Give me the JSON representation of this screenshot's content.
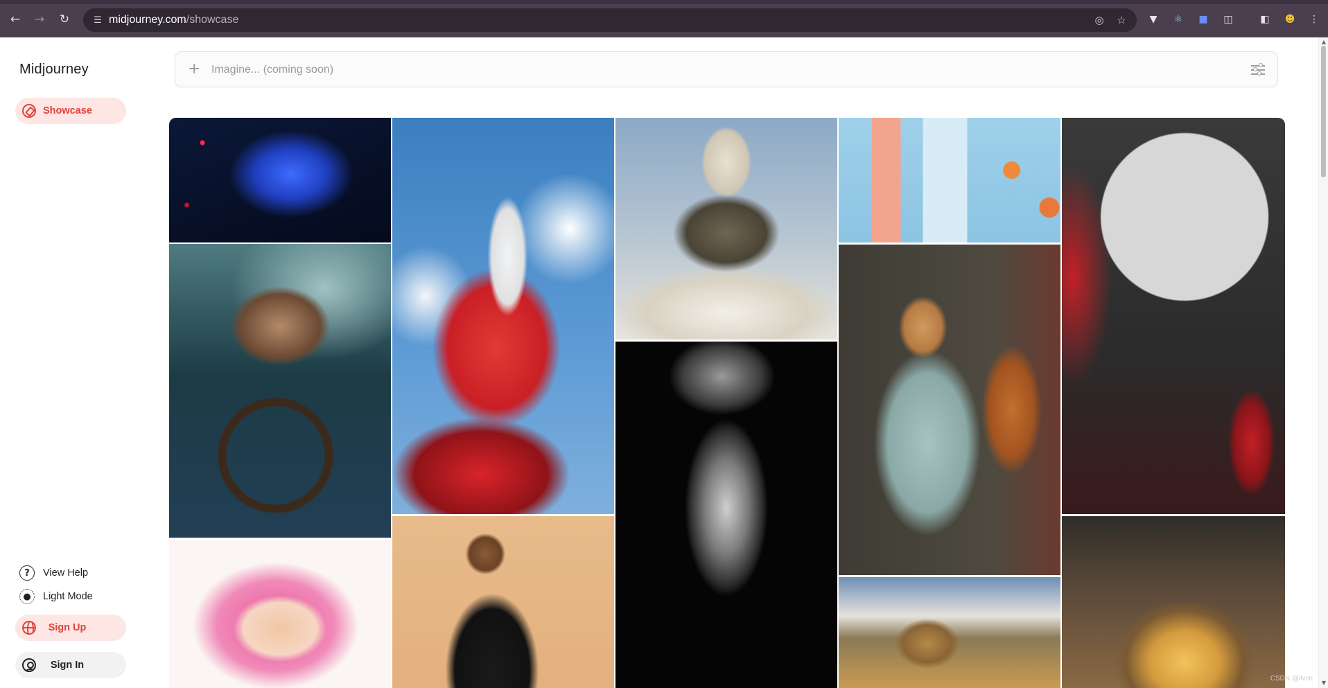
{
  "browser": {
    "url_host": "midjourney.com",
    "url_path": "/showcase",
    "back_icon": "back-arrow-icon",
    "forward_icon": "forward-arrow-icon",
    "reload_icon": "reload-icon"
  },
  "sidebar": {
    "brand": "Midjourney",
    "nav": [
      {
        "label": "Showcase",
        "icon": "compass-icon",
        "active": true
      }
    ],
    "footer": {
      "help": "View Help",
      "light_mode": "Light Mode",
      "sign_up": "Sign Up",
      "sign_in": "Sign In"
    }
  },
  "imagine": {
    "placeholder": "Imagine... (coming soon)",
    "plus_icon": "plus-icon",
    "settings_icon": "sliders-icon"
  },
  "gallery": {
    "images": [
      {
        "subject": "blue armored ninja with dragon",
        "colors": [
          "#0b1838",
          "#1f3fbf",
          "#3e6bff"
        ]
      },
      {
        "subject": "girl sitting on giant strawberry",
        "colors": [
          "#4f8fd0",
          "#d8242a",
          "#f1f3f6"
        ]
      },
      {
        "subject": "floating castle above clouds",
        "colors": [
          "#8ca9c6",
          "#d9d2c3",
          "#6f6652"
        ]
      },
      {
        "subject": "pastel stationery flat lay",
        "colors": [
          "#9fd0ea",
          "#f3a48f",
          "#e8793a"
        ]
      },
      {
        "subject": "gothic castle under moon with red forest",
        "colors": [
          "#2b2b2b",
          "#c22026",
          "#d7d7d7"
        ]
      },
      {
        "subject": "sailor at ship wheel in storm",
        "colors": [
          "#1c3b45",
          "#4f7c80",
          "#3b2a1c"
        ]
      },
      {
        "subject": "metallic cracked face sculpture",
        "colors": [
          "#050505",
          "#7a7a7a",
          "#cfcfcf"
        ]
      },
      {
        "subject": "woman holding giant beetle",
        "colors": [
          "#3e3c34",
          "#a7c3c1",
          "#a2531f"
        ]
      },
      {
        "subject": "pink lion illustration",
        "colors": [
          "#fbf6f4",
          "#e8559c",
          "#f1c7a5"
        ]
      },
      {
        "subject": "woman in black dress illustration",
        "colors": [
          "#e3b07e",
          "#1a1a1a",
          "#8a5b35"
        ]
      },
      {
        "subject": "puma running in mountains",
        "colors": [
          "#6f8fb6",
          "#b48a48",
          "#e6e2dc"
        ]
      },
      {
        "subject": "golden leaf at sunset",
        "colors": [
          "#2f2d2a",
          "#d49b3d",
          "#7a5a33"
        ]
      }
    ]
  },
  "watermark": "CSDN @ilvcn"
}
